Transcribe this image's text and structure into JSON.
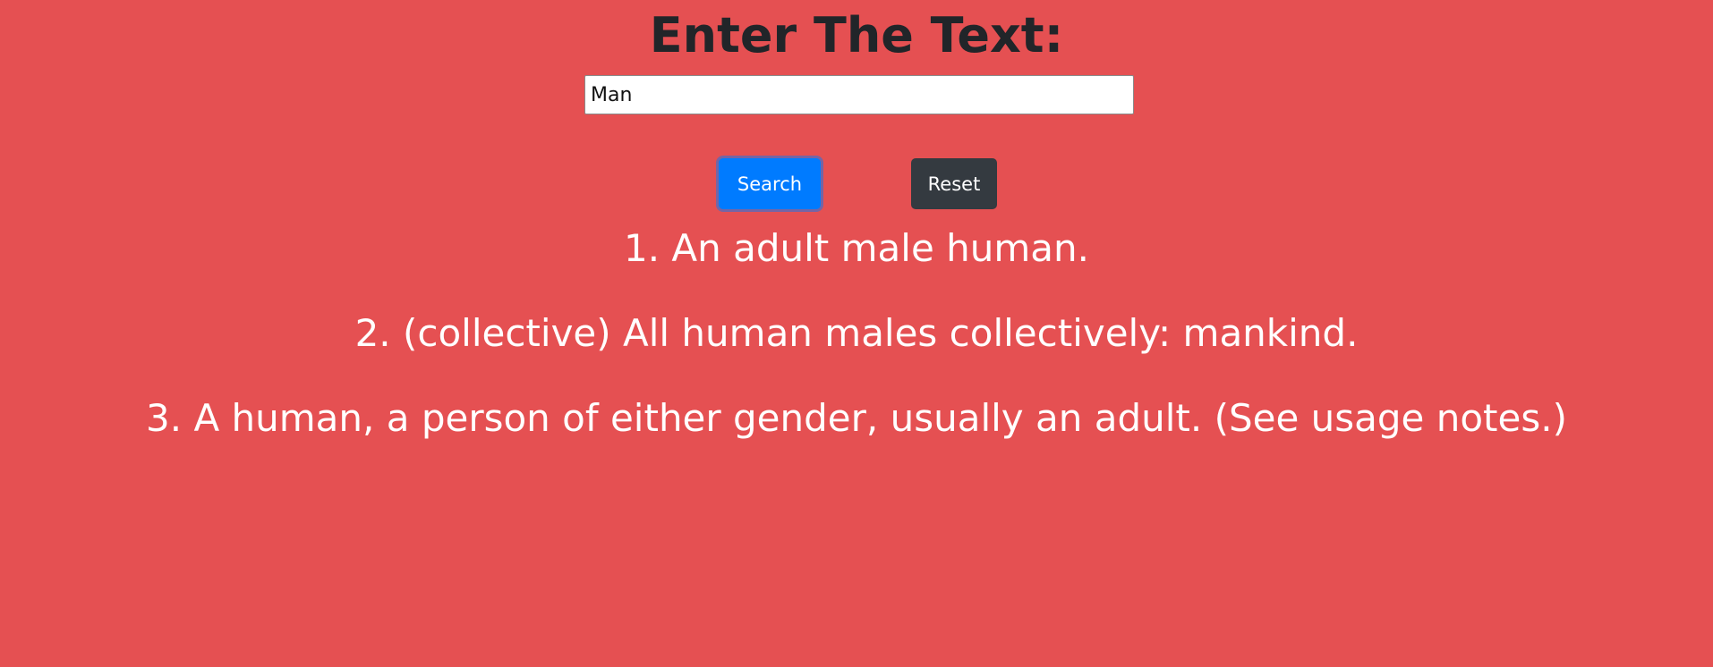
{
  "page": {
    "title": "Enter The Text:",
    "background_color": "#e55052"
  },
  "search": {
    "value": "Man",
    "placeholder": ""
  },
  "buttons": {
    "search_label": "Search",
    "search_color": "#007bff",
    "reset_label": "Reset",
    "reset_color": "#343a40"
  },
  "definitions": [
    "1. An adult male human.",
    "2. (collective) All human males collectively: mankind.",
    "3. A human, a person of either gender, usually an adult. (See usage notes.)"
  ]
}
